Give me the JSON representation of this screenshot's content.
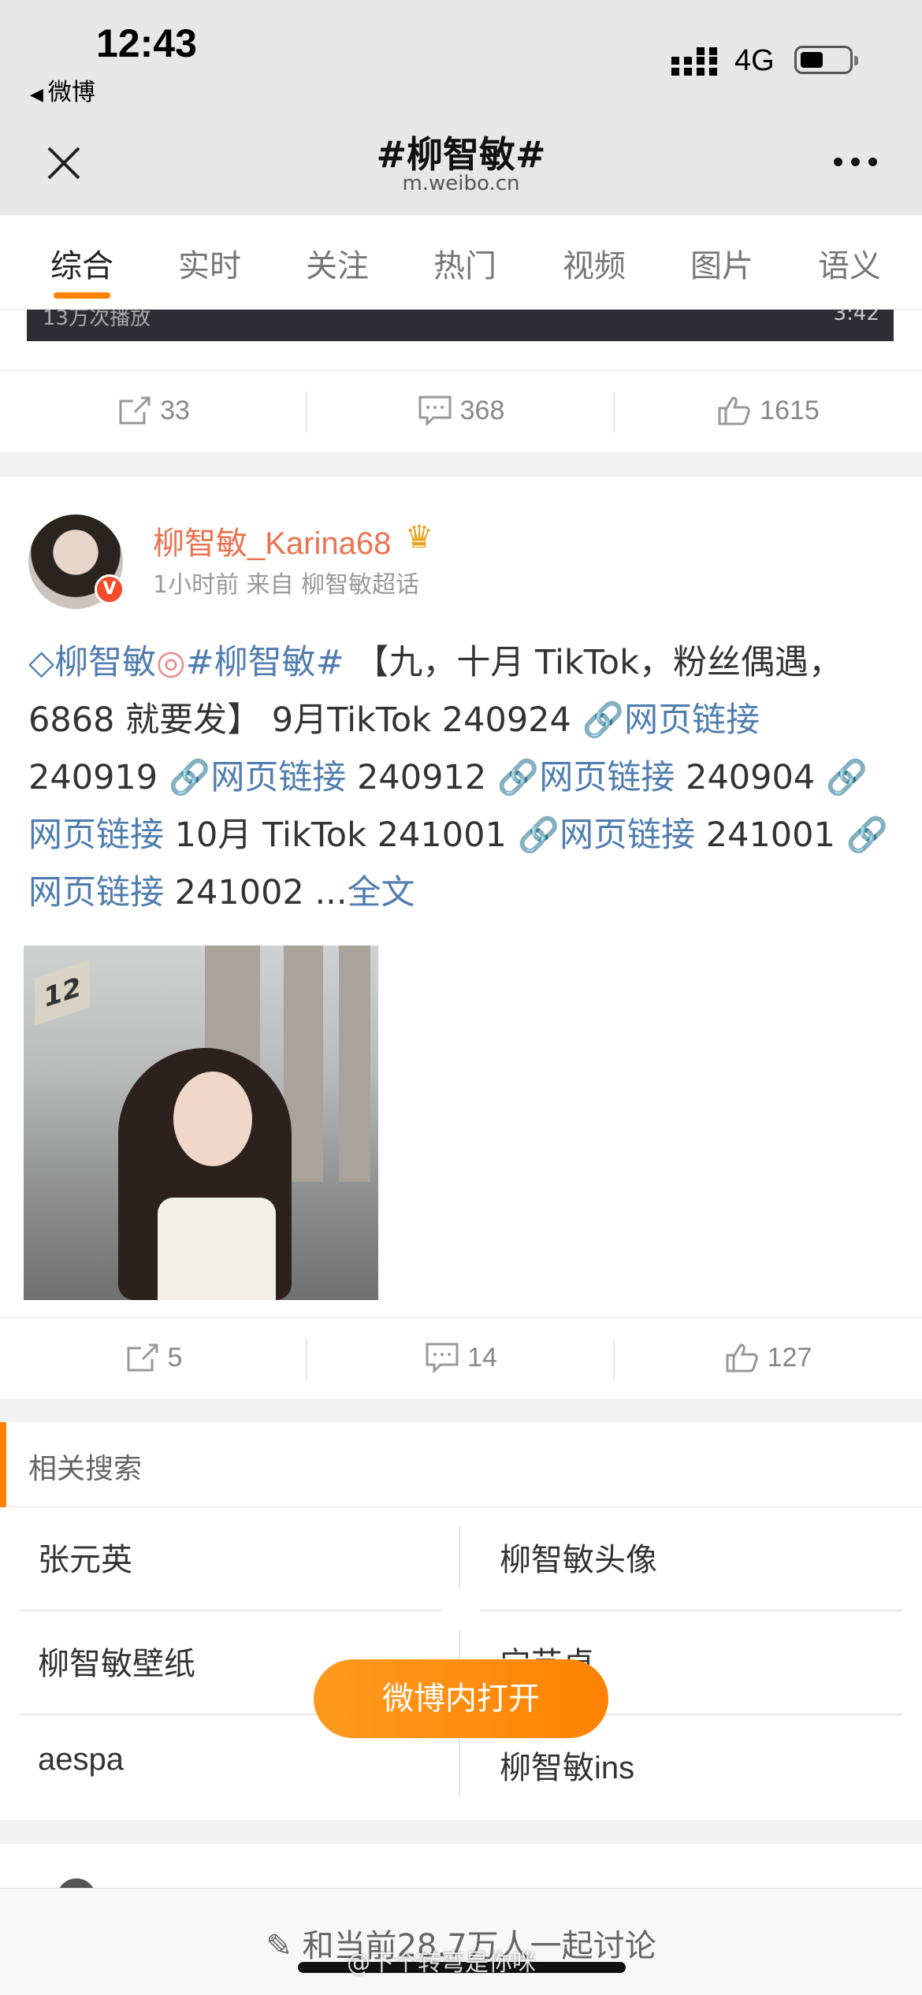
{
  "status_bar": {
    "time": "12:43",
    "back_app": "微博",
    "network": "4G"
  },
  "nav": {
    "title": "#柳智敏#",
    "url": "m.weibo.cn"
  },
  "tabs": [
    {
      "label": "综合"
    },
    {
      "label": "实时"
    },
    {
      "label": "关注"
    },
    {
      "label": "热门"
    },
    {
      "label": "视频"
    },
    {
      "label": "图片"
    },
    {
      "label": "语义"
    }
  ],
  "prev_card": {
    "video_left": "13万次播放",
    "video_right": "3:42",
    "reposts": "33",
    "comments": "368",
    "likes": "1615"
  },
  "post": {
    "username": "柳智敏_Karina68",
    "meta": "1小时前 来自 柳智敏超话",
    "text": {
      "chaohua": "柳智敏",
      "topic": "#柳智敏#",
      "body1": "【九，十月 TikTok，粉丝偶遇，6868 就要发】 9月TikTok 240924",
      "link": "网页链接",
      "d1": "240919",
      "d2": "240912",
      "d3": "240904",
      "mid": "10月 TikTok 241001",
      "d4": "241001",
      "d5": "241002 ...",
      "more": "全文"
    },
    "photo_sign": "12",
    "reposts": "5",
    "comments": "14",
    "likes": "127"
  },
  "related": {
    "title": "相关搜索",
    "items": [
      "张元英",
      "柳智敏头像",
      "柳智敏壁纸",
      "宁艺卓",
      "aespa",
      "柳智敏ins"
    ]
  },
  "open_button": "微博内打开",
  "bottom": {
    "discussion": "和当前28.7万人一起讨论",
    "watermark": "@下个转弯是你咪"
  }
}
